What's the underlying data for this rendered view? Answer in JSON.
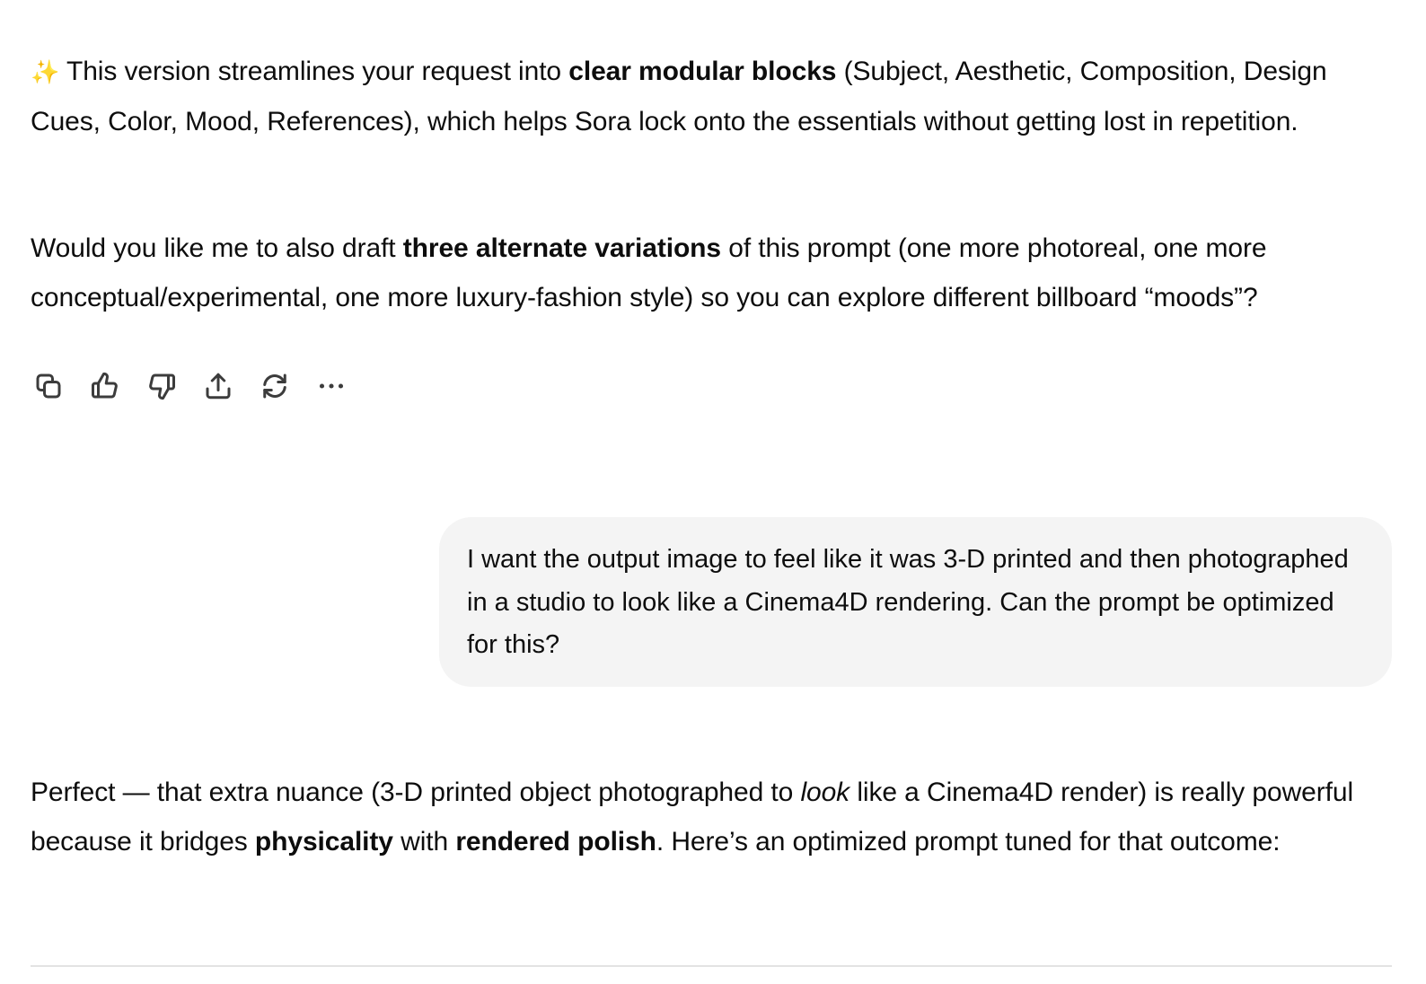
{
  "assistant_message_1": {
    "p1": {
      "sparkle": "✨",
      "before": " This version streamlines your request into ",
      "bold": "clear modular blocks",
      "after": " (Subject, Aesthetic, Composition, Design Cues, Color, Mood, References), which helps Sora lock onto the essentials without getting lost in repetition."
    },
    "p2": {
      "before": "Would you like me to also draft ",
      "bold": "three alternate variations",
      "after": " of this prompt (one more photoreal, one more conceptual/experimental, one more luxury-fashion style) so you can explore different billboard “moods”?"
    }
  },
  "action_bar": {
    "icons": [
      "copy-icon",
      "thumbs-up-icon",
      "thumbs-down-icon",
      "share-icon",
      "regenerate-icon",
      "more-icon"
    ],
    "more_glyph": "⋯"
  },
  "user_message": {
    "text": "I want the output image to feel like it was 3-D printed and then photographed in a studio to look like a Cinema4D rendering. Can the prompt be optimized for this?"
  },
  "assistant_message_2": {
    "p1": {
      "seg1": "Perfect — that extra nuance (3-D printed object photographed to ",
      "italic": "look",
      "seg2": " like a Cinema4D render) is really powerful because it bridges ",
      "bold1": "physicality",
      "seg3": " with ",
      "bold2": "rendered polish",
      "seg4": ". Here’s an optimized prompt tuned for that outcome:"
    }
  },
  "colors": {
    "text": "#0d0d0d",
    "bubble_bg": "#f4f4f4",
    "icon": "#3c3c3c",
    "divider": "#e3e3e3"
  }
}
